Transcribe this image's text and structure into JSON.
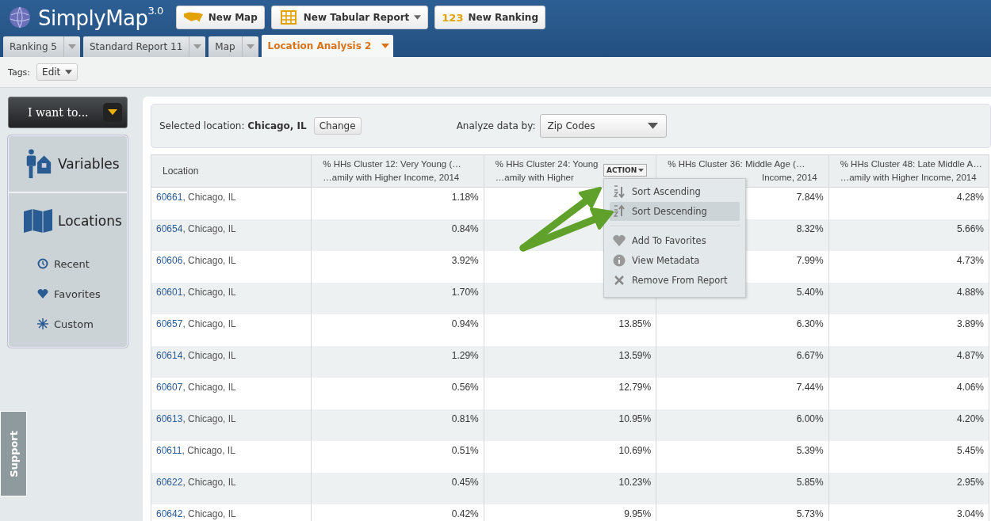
{
  "app": {
    "logo": "SimplyMap$^{3.0}$"
  },
  "toolbar_buttons": [
    {
      "kind": "map",
      "label": "New Map",
      "dropdown": false
    },
    {
      "kind": "grid",
      "label": "New Tabular Report",
      "dropdown": true
    },
    {
      "kind": "ranking",
      "label": "New Ranking",
      "icon_text": "123",
      "dropdown": false
    }
  ],
  "tabs": [
    {
      "label": "Ranking 5",
      "selected": false
    },
    {
      "label": "Standard Report 11",
      "selected": false
    },
    {
      "label": "Map",
      "selected": false
    },
    {
      "label": "Location Analysis 2",
      "selected": true
    }
  ],
  "tags": {
    "label": "Tags:",
    "button": "Edit"
  },
  "sidebar": {
    "action_button": "I want to...",
    "sections": [
      {
        "kind": "variables",
        "label": "Variables"
      },
      {
        "kind": "locations",
        "label": "Locations"
      }
    ],
    "items": [
      {
        "kind": "recent",
        "label": "Recent"
      },
      {
        "kind": "favorites",
        "label": "Favorites"
      },
      {
        "kind": "custom",
        "label": "Custom"
      }
    ],
    "support": "Support"
  },
  "filter": {
    "selected_location": "Selected location: **Chicago, IL**",
    "change_button": "Change",
    "analyze_label": "Analyze data by:",
    "analyze_value": "Zip Codes"
  },
  "table": {
    "columns": [
      {
        "line1": "Location"
      },
      {
        "line1": "% HHs Cluster 12: Very Young (…",
        "line2": "…amily with Higher Income, 2014",
        "covered": false
      },
      {
        "line1": "% HHs Cluster 24: Young",
        "line2": "…amily with Higher",
        "covered": false
      },
      {
        "line1": "% HHs Cluster 36: Middle Age (…",
        "line2": "Income, 2014",
        "covered": true
      },
      {
        "line1": "% HHs Cluster 48: Late Middle A…",
        "line2": "…amily with Higher Income, 2014",
        "covered": false
      }
    ],
    "rows": [
      {
        "zip": "60661",
        "place": ", Chicago, IL",
        "value_1": "1.18%",
        "value_3": "7.84%",
        "value_4": "4.28%"
      },
      {
        "zip": "60654",
        "place": ", Chicago, IL",
        "value_1": "0.84%",
        "value_3": "8.32%",
        "value_4": "5.66%"
      },
      {
        "zip": "60606",
        "place": ", Chicago, IL",
        "value_1": "3.92%",
        "value_3": "7.99%",
        "value_4": "4.73%"
      },
      {
        "zip": "60601",
        "place": ", Chicago, IL",
        "value_1": "1.70%",
        "value_3": "5.40%",
        "value_4": "4.88%"
      },
      {
        "zip": "60657",
        "place": ", Chicago, IL",
        "value_1": "0.94%",
        "value_2": "13.85%",
        "value_3": "6.30%",
        "value_4": "3.89%"
      },
      {
        "zip": "60614",
        "place": ", Chicago, IL",
        "value_1": "1.29%",
        "value_2": "13.59%",
        "value_3": "6.67%",
        "value_4": "4.87%"
      },
      {
        "zip": "60607",
        "place": ", Chicago, IL",
        "value_1": "0.56%",
        "value_2": "12.79%",
        "value_3": "7.44%",
        "value_4": "4.06%"
      },
      {
        "zip": "60613",
        "place": ", Chicago, IL",
        "value_1": "0.81%",
        "value_2": "10.95%",
        "value_3": "6.00%",
        "value_4": "4.20%"
      },
      {
        "zip": "60611",
        "place": ", Chicago, IL",
        "value_1": "0.51%",
        "value_2": "10.69%",
        "value_3": "5.39%",
        "value_4": "5.45%"
      },
      {
        "zip": "60622",
        "place": ", Chicago, IL",
        "value_1": "0.45%",
        "value_2": "10.23%",
        "value_3": "5.85%",
        "value_4": "2.95%"
      },
      {
        "zip": "60642",
        "place": ", Chicago, IL",
        "value_1": "0.42%",
        "value_2": "9.95%",
        "value_3": "5.73%",
        "value_4": "3.04%"
      }
    ]
  },
  "action_button": "ACTION",
  "action_menu": [
    {
      "kind": "sort-asc",
      "label": "Sort Ascending",
      "selected": false
    },
    {
      "kind": "sort-desc",
      "label": "Sort Descending",
      "selected": true
    },
    {
      "kind": "favorite",
      "label": "Add To Favorites",
      "selected": false
    },
    {
      "kind": "metadata",
      "label": "View Metadata",
      "selected": false
    },
    {
      "kind": "remove",
      "label": "Remove From Report",
      "selected": false
    }
  ]
}
